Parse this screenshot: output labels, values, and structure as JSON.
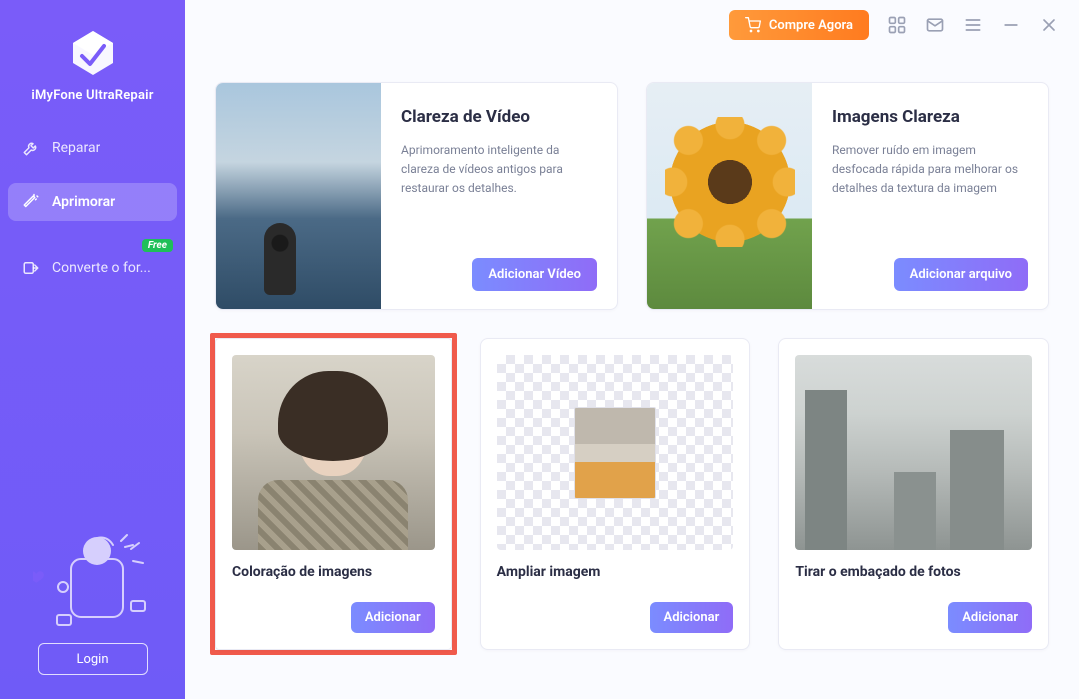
{
  "app": {
    "name": "iMyFone UltraRepair"
  },
  "titlebar": {
    "buy_label": "Compre Agora"
  },
  "sidebar": {
    "nav": {
      "repair": "Reparar",
      "enhance": "Aprimorar",
      "convert": "Converte o for...",
      "convert_badge": "Free"
    },
    "login_label": "Login"
  },
  "cards": {
    "video_clarity": {
      "title": "Clareza de Vídeo",
      "desc": "Aprimoramento inteligente da clareza de vídeos antigos para restaurar os detalhes.",
      "btn": "Adicionar Vídeo"
    },
    "image_clarity": {
      "title": "Imagens Clareza",
      "desc": "Remover ruído em imagem desfocada rápida  para melhorar os detalhes da textura da imagem",
      "btn": "Adicionar arquivo"
    },
    "colorize": {
      "title": "Coloração de imagens",
      "btn": "Adicionar"
    },
    "enlarge": {
      "title": "Ampliar imagem",
      "btn": "Adicionar"
    },
    "unblur": {
      "title": "Tirar o embaçado de fotos",
      "btn": "Adicionar"
    }
  }
}
